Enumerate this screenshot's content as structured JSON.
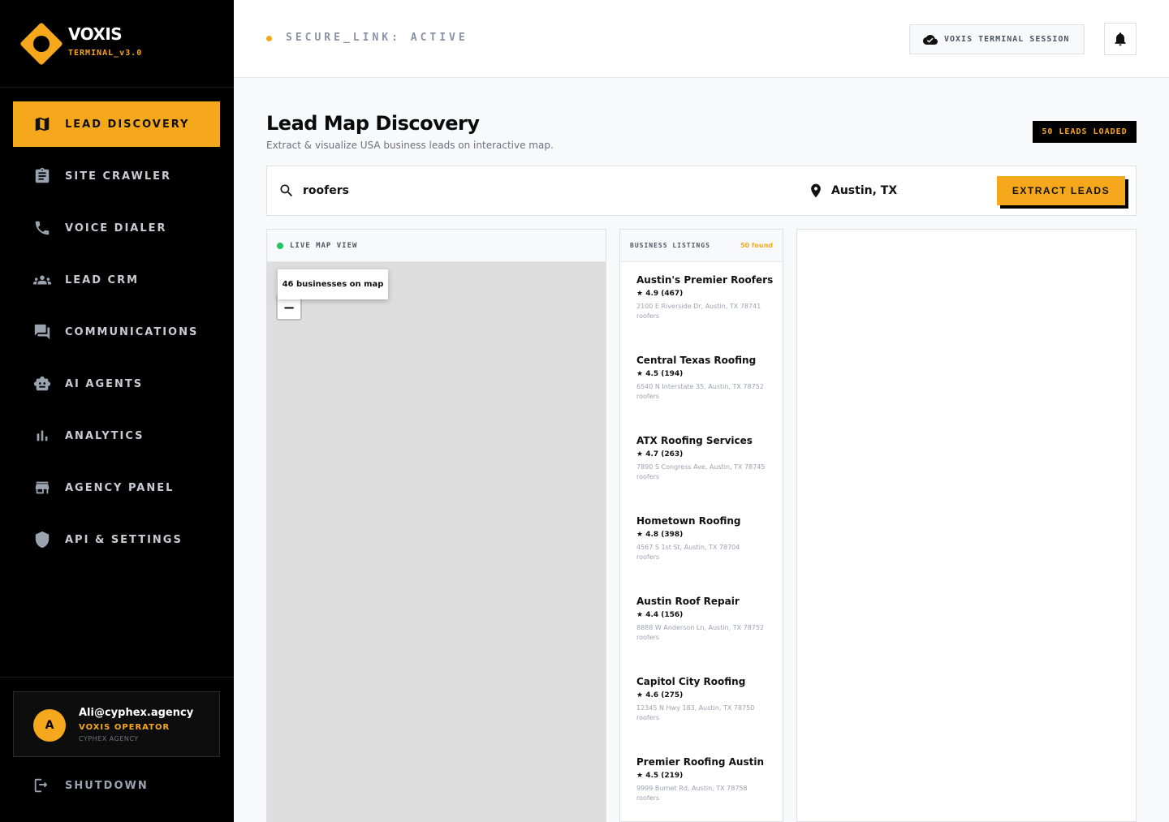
{
  "brand": {
    "name": "VOXIS",
    "version": "TERMINAL_v3.0"
  },
  "sidebar": {
    "items": [
      {
        "label": "LEAD DISCOVERY",
        "icon": "map-icon",
        "active": true
      },
      {
        "label": "SITE CRAWLER",
        "icon": "clipboard-icon"
      },
      {
        "label": "VOICE DIALER",
        "icon": "phone-icon"
      },
      {
        "label": "LEAD CRM",
        "icon": "people-icon"
      },
      {
        "label": "COMMUNICATIONS",
        "icon": "chat-icon"
      },
      {
        "label": "AI AGENTS",
        "icon": "robot-icon"
      },
      {
        "label": "ANALYTICS",
        "icon": "bar-chart-icon"
      },
      {
        "label": "AGENCY PANEL",
        "icon": "storefront-icon"
      },
      {
        "label": "API & SETTINGS",
        "icon": "shield-icon"
      }
    ],
    "user": {
      "initial": "A",
      "email": "Ali@cyphex.agency",
      "role": "VOXIS OPERATOR",
      "agency": "CYPHEX AGENCY"
    },
    "shutdown_label": "SHUTDOWN"
  },
  "topbar": {
    "status": "SECURE_LINK: ACTIVE",
    "session_label": "VOXIS TERMINAL SESSION"
  },
  "header": {
    "title": "Lead Map Discovery",
    "subtitle": "Extract & visualize USA business leads on interactive map.",
    "badge": "50 LEADS LOADED"
  },
  "search": {
    "query": "roofers",
    "location": "Austin, TX",
    "button": "EXTRACT LEADS"
  },
  "map": {
    "header": "LIVE MAP VIEW",
    "tooltip": "46 businesses on map",
    "zoom_out": "−"
  },
  "listings": {
    "header": "BUSINESS LISTINGS",
    "count": "50 found",
    "items": [
      {
        "name": "Austin's Premier Roofers",
        "rating": "★  4.9 (467)",
        "address": "2100 E Riverside Dr, Austin, TX 78741",
        "category": "roofers"
      },
      {
        "name": "Central Texas Roofing",
        "rating": "★  4.5 (194)",
        "address": "6540 N Interstate 35, Austin, TX 78752",
        "category": "roofers"
      },
      {
        "name": "ATX Roofing Services",
        "rating": "★  4.7 (263)",
        "address": "7890 S Congress Ave, Austin, TX 78745",
        "category": "roofers"
      },
      {
        "name": "Hometown Roofing",
        "rating": "★  4.8 (398)",
        "address": "4567 S 1st St, Austin, TX 78704",
        "category": "roofers"
      },
      {
        "name": "Austin Roof Repair",
        "rating": "★  4.4 (156)",
        "address": "8888 W Anderson Ln, Austin, TX 78752",
        "category": "roofers"
      },
      {
        "name": "Capitol City Roofing",
        "rating": "★  4.6 (275)",
        "address": "12345 N Hwy 183, Austin, TX 78750",
        "category": "roofers"
      },
      {
        "name": "Premier Roofing Austin",
        "rating": "★  4.5 (219)",
        "address": "9999 Burnet Rd, Austin, TX 78758",
        "category": "roofers"
      }
    ]
  },
  "colors": {
    "accent": "#f5a81c",
    "sidebar_bg": "#000000",
    "live": "#22c55e"
  }
}
